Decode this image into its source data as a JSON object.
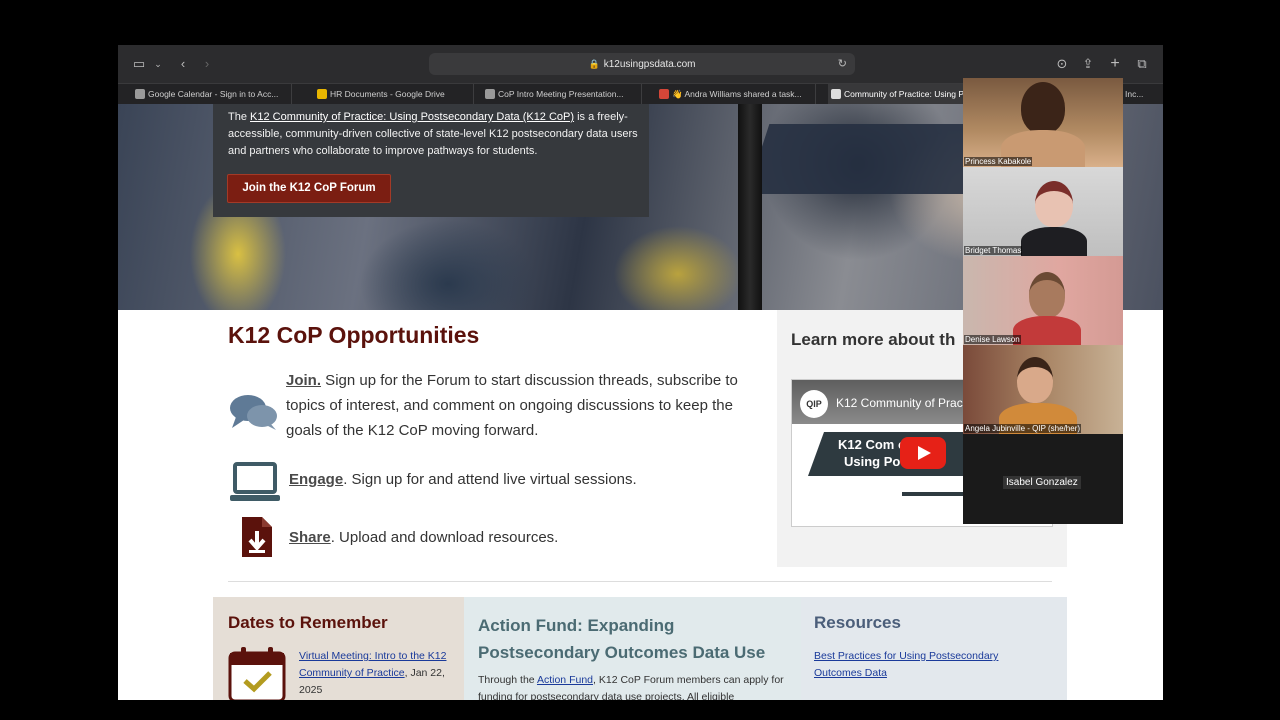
{
  "browser": {
    "url": "k12usingpsdata.com",
    "tabs": [
      {
        "label": "Google Calendar - Sign in to Acc..."
      },
      {
        "label": "HR Documents - Google Drive"
      },
      {
        "label": "CoP Intro Meeting Presentation..."
      },
      {
        "label": "👋 Andra Williams shared a task..."
      },
      {
        "label": "Community of Practice: Using P"
      },
      {
        "label": "Inc..."
      }
    ]
  },
  "hero": {
    "intro_prefix": "The ",
    "intro_link": "K12 Community of Practice: Using Postsecondary Data (K12 CoP)",
    "intro_suffix": " is a freely-accessible, community-driven collective of state-level K12 postsecondary data users and partners who collaborate to improve pathways for students.",
    "join_button": "Join the K12 CoP Forum"
  },
  "opportunities": {
    "title": "K12 CoP Opportunities",
    "items": [
      {
        "link": "Join.",
        "text": " Sign up for the Forum to start discussion threads, subscribe to topics of interest, and comment on ongoing discussions to keep the goals of the K12 CoP moving forward."
      },
      {
        "link": "Engage",
        "text": ". Sign up for and attend live virtual sessions."
      },
      {
        "link": "Share",
        "text": ". Upload and download resources."
      }
    ]
  },
  "learn_more": {
    "title": "Learn more about th",
    "video": {
      "logo": "QIP",
      "title": "K12 Community of Prac",
      "banner_line1": "K12 Com        of",
      "banner_line2": "Using Po        nda"
    }
  },
  "dates": {
    "title": "Dates to Remember",
    "event_link": "Virtual Meeting: Intro to the K12 Community of Practice",
    "event_date": ", Jan 22, 2025"
  },
  "action_fund": {
    "title": "Action Fund: Expanding Postsecondary Outcomes Data Use",
    "text_prefix": "Through the ",
    "text_link": "Action Fund",
    "text_suffix": ", K12 CoP Forum members can apply for funding for postsecondary data use projects. All eligible"
  },
  "resources": {
    "title": "Resources",
    "link": "Best Practices for Using Postsecondary Outcomes Data"
  },
  "participants": [
    {
      "name": "Princess Kabakole"
    },
    {
      "name": "Bridget Thomas"
    },
    {
      "name": "Denise Lawson"
    },
    {
      "name": "Angela Jubinville - QIP (she/her)"
    },
    {
      "name": "Isabel Gonzalez"
    }
  ]
}
